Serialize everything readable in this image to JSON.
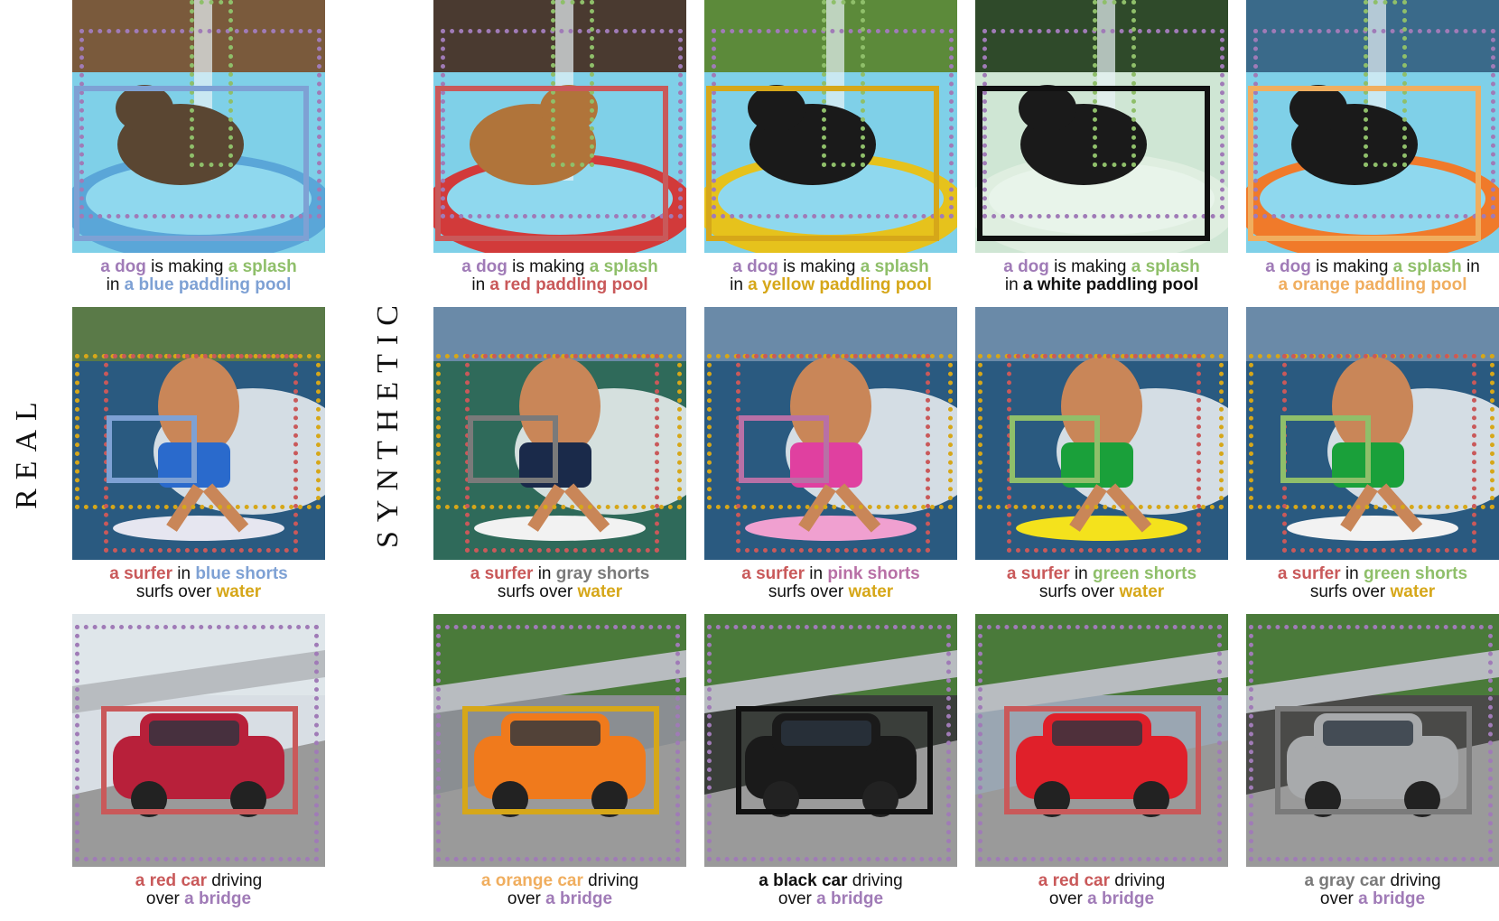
{
  "labels": {
    "real": "REAL",
    "synthetic": "SYNTHETIC"
  },
  "colors": {
    "purple": "#a07bb7",
    "green": "#8fbf6a",
    "blue": "#7ea1d4",
    "red": "#c9595a",
    "yellow": "#d6a719",
    "black": "#111111",
    "orange": "#f0ae5f",
    "gray": "#7a7a7a",
    "pink": "#b870a6",
    "bright_green": "#6ab04c"
  },
  "rows": [
    {
      "cells": [
        {
          "line1": [
            {
              "t": "a dog",
              "c": "purple"
            },
            {
              "t": " is making ",
              "c": "plain"
            },
            {
              "t": "a splash",
              "c": "green"
            }
          ],
          "line2": [
            {
              "t": "in ",
              "c": "plain"
            },
            {
              "t": "a blue paddling pool",
              "c": "blue"
            }
          ]
        },
        {
          "line1": [
            {
              "t": "a dog",
              "c": "purple"
            },
            {
              "t": " is making ",
              "c": "plain"
            },
            {
              "t": "a splash",
              "c": "green"
            }
          ],
          "line2": [
            {
              "t": "in ",
              "c": "plain"
            },
            {
              "t": "a red paddling pool",
              "c": "red"
            }
          ]
        },
        {
          "line1": [
            {
              "t": "a dog",
              "c": "purple"
            },
            {
              "t": " is making ",
              "c": "plain"
            },
            {
              "t": "a splash",
              "c": "green"
            }
          ],
          "line2": [
            {
              "t": "in ",
              "c": "plain"
            },
            {
              "t": "a yellow paddling pool",
              "c": "yellow"
            }
          ]
        },
        {
          "line1": [
            {
              "t": "a dog",
              "c": "purple"
            },
            {
              "t": " is making ",
              "c": "plain"
            },
            {
              "t": "a splash",
              "c": "green"
            }
          ],
          "line2": [
            {
              "t": "in ",
              "c": "plain"
            },
            {
              "t": "a white paddling pool",
              "c": "black"
            }
          ]
        },
        {
          "line1": [
            {
              "t": "a dog",
              "c": "purple"
            },
            {
              "t": " is making ",
              "c": "plain"
            },
            {
              "t": "a splash",
              "c": "green"
            },
            {
              "t": " in",
              "c": "plain"
            }
          ],
          "line2": [
            {
              "t": "a orange paddling pool",
              "c": "orange"
            }
          ]
        }
      ]
    },
    {
      "cells": [
        {
          "line1": [
            {
              "t": "a surfer",
              "c": "red"
            },
            {
              "t": " in ",
              "c": "plain"
            },
            {
              "t": "blue shorts",
              "c": "blue"
            }
          ],
          "line2": [
            {
              "t": "surfs over ",
              "c": "plain"
            },
            {
              "t": "water",
              "c": "yellow"
            }
          ]
        },
        {
          "line1": [
            {
              "t": "a surfer",
              "c": "red"
            },
            {
              "t": " in ",
              "c": "plain"
            },
            {
              "t": "gray shorts",
              "c": "gray"
            }
          ],
          "line2": [
            {
              "t": "surfs over ",
              "c": "plain"
            },
            {
              "t": "water",
              "c": "yellow"
            }
          ]
        },
        {
          "line1": [
            {
              "t": "a surfer",
              "c": "red"
            },
            {
              "t": " in ",
              "c": "plain"
            },
            {
              "t": "pink shorts",
              "c": "pink"
            }
          ],
          "line2": [
            {
              "t": "surfs over ",
              "c": "plain"
            },
            {
              "t": "water",
              "c": "yellow"
            }
          ]
        },
        {
          "line1": [
            {
              "t": "a surfer",
              "c": "red"
            },
            {
              "t": " in ",
              "c": "plain"
            },
            {
              "t": "green shorts",
              "c": "green"
            }
          ],
          "line2": [
            {
              "t": "surfs over ",
              "c": "plain"
            },
            {
              "t": "water",
              "c": "yellow"
            }
          ]
        },
        {
          "line1": [
            {
              "t": "a surfer",
              "c": "red"
            },
            {
              "t": " in ",
              "c": "plain"
            },
            {
              "t": "green shorts",
              "c": "green"
            }
          ],
          "line2": [
            {
              "t": "surfs over ",
              "c": "plain"
            },
            {
              "t": "water",
              "c": "yellow"
            }
          ]
        }
      ]
    },
    {
      "cells": [
        {
          "line1": [
            {
              "t": "a red car",
              "c": "red"
            },
            {
              "t": " driving",
              "c": "plain"
            }
          ],
          "line2": [
            {
              "t": "over ",
              "c": "plain"
            },
            {
              "t": "a bridge",
              "c": "purple"
            }
          ]
        },
        {
          "line1": [
            {
              "t": "a orange car",
              "c": "orange"
            },
            {
              "t": " driving",
              "c": "plain"
            }
          ],
          "line2": [
            {
              "t": "over ",
              "c": "plain"
            },
            {
              "t": "a bridge",
              "c": "purple"
            }
          ]
        },
        {
          "line1": [
            {
              "t": "a black car",
              "c": "black"
            },
            {
              "t": " driving",
              "c": "plain"
            }
          ],
          "line2": [
            {
              "t": "over ",
              "c": "plain"
            },
            {
              "t": "a bridge",
              "c": "purple"
            }
          ]
        },
        {
          "line1": [
            {
              "t": "a red car",
              "c": "red"
            },
            {
              "t": " driving",
              "c": "plain"
            }
          ],
          "line2": [
            {
              "t": "over ",
              "c": "plain"
            },
            {
              "t": "a bridge",
              "c": "purple"
            }
          ]
        },
        {
          "line1": [
            {
              "t": "a gray car",
              "c": "gray"
            },
            {
              "t": " driving",
              "c": "plain"
            }
          ],
          "line2": [
            {
              "t": "over ",
              "c": "plain"
            },
            {
              "t": "a bridge",
              "c": "purple"
            }
          ]
        }
      ]
    }
  ]
}
